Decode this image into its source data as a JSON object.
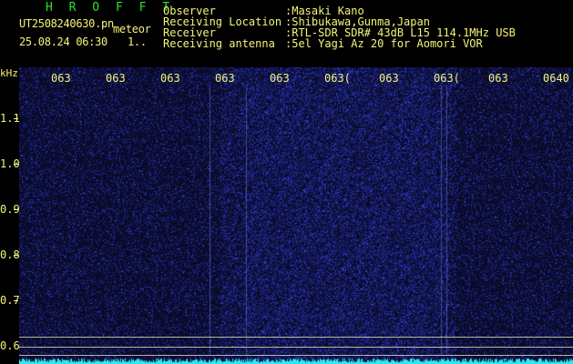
{
  "header": {
    "brand": "H R O F F T",
    "filename": "UT2508240630.pn",
    "tag": "meteor",
    "date": "25.08.24 06:30",
    "extra": "1..",
    "rows": [
      {
        "label": "Observer",
        "value": ":Masaki Kano"
      },
      {
        "label": "Receiving Location",
        "value": ":Shibukawa,Gunma,Japan"
      },
      {
        "label": "Receiver",
        "value": ":RTL-SDR SDR# 43dB L15 114.1MHz USB"
      },
      {
        "label": "Receiving antenna",
        "value": ":5el Yagi Az 20 for Aomori VOR"
      }
    ]
  },
  "spectrogram": {
    "y_unit": "kHz",
    "y_ticks": [
      "1.1",
      "1.0",
      "0.9",
      "0.8",
      "0.7",
      "0.6"
    ],
    "x_ticks": [
      "063",
      "063",
      "063",
      "063",
      "063",
      "063(",
      "063",
      "063(",
      "063",
      "0640"
    ],
    "colors": {
      "background": "#000428",
      "noise": "#1a2fd6",
      "baseline": "#2ee8f0",
      "text": "#f4f47a",
      "brand": "#27e627"
    }
  }
}
